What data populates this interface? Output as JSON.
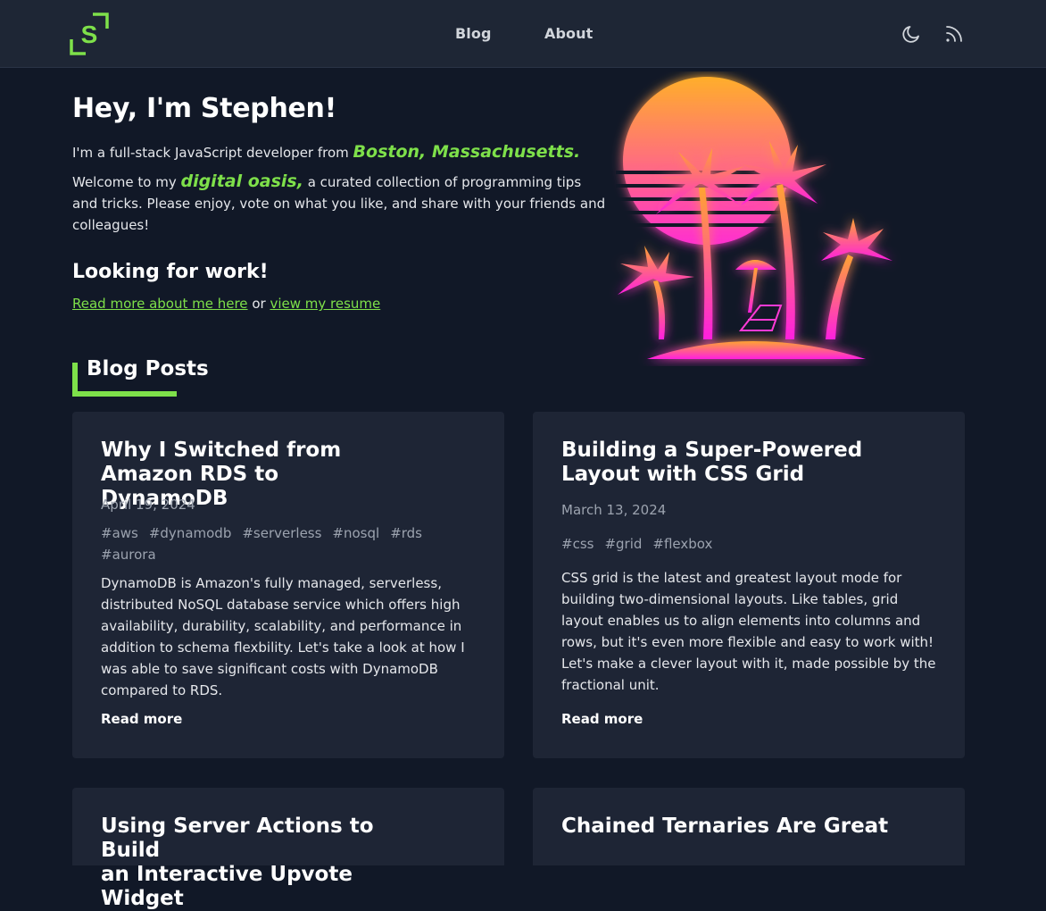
{
  "header": {
    "logo_letter": "S",
    "nav": [
      {
        "label": "Blog"
      },
      {
        "label": "About"
      }
    ],
    "icons": [
      "moon-icon",
      "rss-icon"
    ]
  },
  "hero": {
    "title": "Hey, I'm Stephen!",
    "intro_prefix": "I'm a full-stack JavaScript developer from ",
    "location": "Boston, Massachusetts.",
    "welcome_prefix": "Welcome to my ",
    "welcome_accent": "digital oasis,",
    "welcome_suffix": " a curated collection of programming tips and tricks. Please enjoy, vote on what you like, and share with your friends and colleagues!",
    "work_title": "Looking for work!",
    "about_link": "Read more about me here",
    "links_joiner": " or ",
    "resume_link": "view my resume"
  },
  "blog": {
    "section_title": "Blog Posts",
    "posts": [
      {
        "title_line1": "Why I Switched from",
        "title_line2": "Amazon RDS to DynamoDB",
        "date": "April 19, 2024",
        "tags": [
          "#aws",
          "#dynamodb",
          "#serverless",
          "#nosql",
          "#rds",
          "#aurora"
        ],
        "description": "DynamoDB is Amazon's fully managed, serverless, distributed NoSQL database service which offers high availability, durability, scalability, and performance in addition to schema flexbility. Let's take a look at how I was able to save significant costs with DynamoDB compared to RDS.",
        "read_more": "Read more"
      },
      {
        "title_line1": "Building a Super-Powered",
        "title_line2": "Layout with CSS Grid",
        "date": "March 13, 2024",
        "tags": [
          "#css",
          "#grid",
          "#flexbox"
        ],
        "description": "CSS grid is the latest and greatest layout mode for building two-dimensional layouts. Like tables, grid layout enables us to align elements into columns and rows, but it's even more flexible and easy to work with! Let's make a clever layout with it, made possible by the fractional unit.",
        "read_more": "Read more"
      },
      {
        "title_line1": "Using Server Actions to Build",
        "title_line2": "an Interactive Upvote Widget"
      },
      {
        "title_line1": "Chained Ternaries Are Great",
        "title_line2": ""
      }
    ]
  },
  "colors": {
    "background": "#111827",
    "header": "#1e2635",
    "card": "#1e2535",
    "accent": "#7ee04a",
    "muted": "#9ca3af"
  }
}
